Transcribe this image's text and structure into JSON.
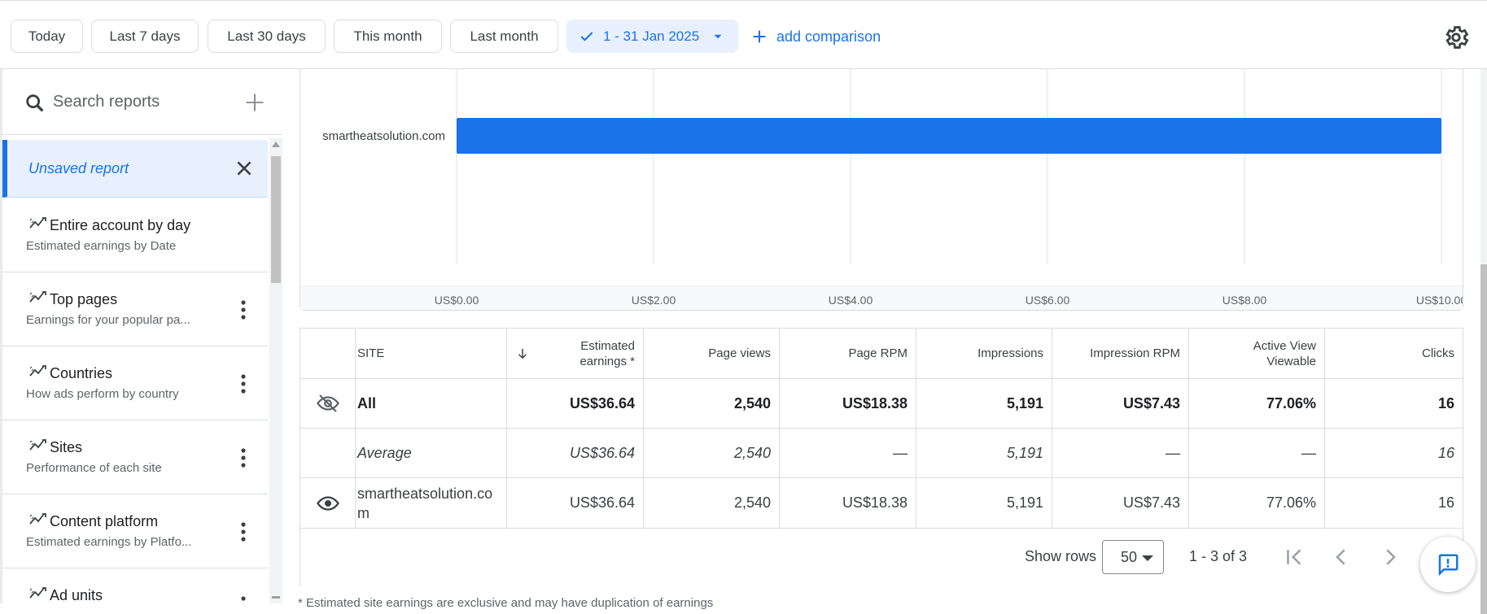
{
  "date_chips": [
    "Today",
    "Last 7 days",
    "Last 30 days",
    "This month",
    "Last month"
  ],
  "date_range": "1 - 31 Jan 2025",
  "add_comparison": "add comparison",
  "search": {
    "placeholder": "Search reports"
  },
  "sidebar": {
    "unsaved": "Unsaved report",
    "items": [
      {
        "title": "Entire account by day",
        "subtitle": "Estimated earnings by Date"
      },
      {
        "title": "Top pages",
        "subtitle": "Earnings for your popular pa..."
      },
      {
        "title": "Countries",
        "subtitle": "How ads perform by country"
      },
      {
        "title": "Sites",
        "subtitle": "Performance of each site"
      },
      {
        "title": "Content platform",
        "subtitle": "Estimated earnings by Platfo..."
      },
      {
        "title": "Ad units",
        "subtitle": ""
      }
    ]
  },
  "chart_data": {
    "type": "bar",
    "orientation": "horizontal",
    "categories": [
      "smartheatsolution.com"
    ],
    "values": [
      36.64
    ],
    "xlim": [
      0,
      10
    ],
    "xticks": [
      "US$0.00",
      "US$2.00",
      "US$4.00",
      "US$6.00",
      "US$8.00",
      "US$10.00"
    ],
    "bar_color": "#1a73e8",
    "grid": true
  },
  "table": {
    "headers": {
      "site": "SITE",
      "earnings": "Estimated earnings *",
      "page_views": "Page views",
      "page_rpm": "Page RPM",
      "impressions": "Impressions",
      "impression_rpm": "Impression RPM",
      "viewable": "Active View Viewable",
      "clicks": "Clicks"
    },
    "rows": [
      {
        "site": "All",
        "earnings": "US$36.64",
        "page_views": "2,540",
        "page_rpm": "US$18.38",
        "impressions": "5,191",
        "impression_rpm": "US$7.43",
        "viewable": "77.06%",
        "clicks": "16"
      },
      {
        "site": "Average",
        "earnings": "US$36.64",
        "page_views": "2,540",
        "page_rpm": "—",
        "impressions": "5,191",
        "impression_rpm": "—",
        "viewable": "—",
        "clicks": "16"
      },
      {
        "site": "smartheatsolution.com",
        "earnings": "US$36.64",
        "page_views": "2,540",
        "page_rpm": "US$18.38",
        "impressions": "5,191",
        "impression_rpm": "US$7.43",
        "viewable": "77.06%",
        "clicks": "16"
      }
    ],
    "show_rows_label": "Show rows",
    "rows_per_page": "50",
    "page_info": "1 - 3 of 3"
  },
  "footnote": "* Estimated site earnings are exclusive and may have duplication of earnings"
}
